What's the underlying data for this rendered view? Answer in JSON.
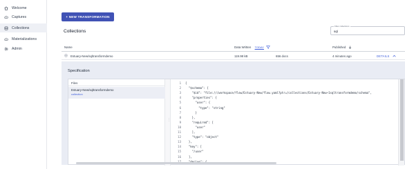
{
  "sidebar": {
    "items": [
      {
        "label": "Welcome",
        "icon": "home-icon"
      },
      {
        "label": "Captures",
        "icon": "cloud-upload-icon"
      },
      {
        "label": "Collections",
        "icon": "database-icon",
        "active": true
      },
      {
        "label": "Materializations",
        "icon": "cloud-download-icon"
      },
      {
        "label": "Admin",
        "icon": "gear-icon"
      }
    ]
  },
  "toolbar": {
    "new_transformation_label": "+ NEW TRANSFORMATION"
  },
  "page": {
    "title": "Collections"
  },
  "filter": {
    "legend": "Filter collections",
    "value": "sql"
  },
  "table": {
    "columns": {
      "name": "Name",
      "data_written": "Data Written",
      "today": "TODAY",
      "published": "Published"
    },
    "rows": [
      {
        "name": "Estuary-New/sqltransformdemo",
        "data_written": "119.98 kB",
        "docs": "656 docs",
        "published": "4 minutes ago",
        "action": "DETAILS"
      }
    ]
  },
  "specification": {
    "title": "Specification",
    "files_header": "Files",
    "file": {
      "name": "Estuary-New/sqltransformdemo",
      "type": "collection"
    },
    "code_lines": [
      {
        "n": "1",
        "text": "{"
      },
      {
        "n": "2",
        "text": "  \"$schema\": {"
      },
      {
        "n": "3",
        "text": "    \"$id\": \"file:///workspace/flow/Estuary-New/flow.yaml?ptr=/collections/Estuary-New~1sqltransformdemo/schema\","
      },
      {
        "n": "4",
        "text": "    \"properties\": {"
      },
      {
        "n": "5",
        "text": "      \"user\": {"
      },
      {
        "n": "6",
        "text": "        \"type\": \"string\""
      },
      {
        "n": "7",
        "text": "      }"
      },
      {
        "n": "8",
        "text": "    },"
      },
      {
        "n": "9",
        "text": "    \"required\": ["
      },
      {
        "n": "10",
        "text": "      \"user\""
      },
      {
        "n": "11",
        "text": "    ],"
      },
      {
        "n": "12",
        "text": "    \"type\": \"object\""
      },
      {
        "n": "13",
        "text": "  },"
      },
      {
        "n": "14",
        "text": "  \"key\": ["
      },
      {
        "n": "15",
        "text": "    \"/user\""
      },
      {
        "n": "16",
        "text": "  ],"
      },
      {
        "n": "17",
        "text": "  \"derive\": {"
      }
    ]
  },
  "colors": {
    "accent": "#4052b5",
    "link": "#3b5bdb",
    "panel_bg": "#e9ecf4"
  }
}
